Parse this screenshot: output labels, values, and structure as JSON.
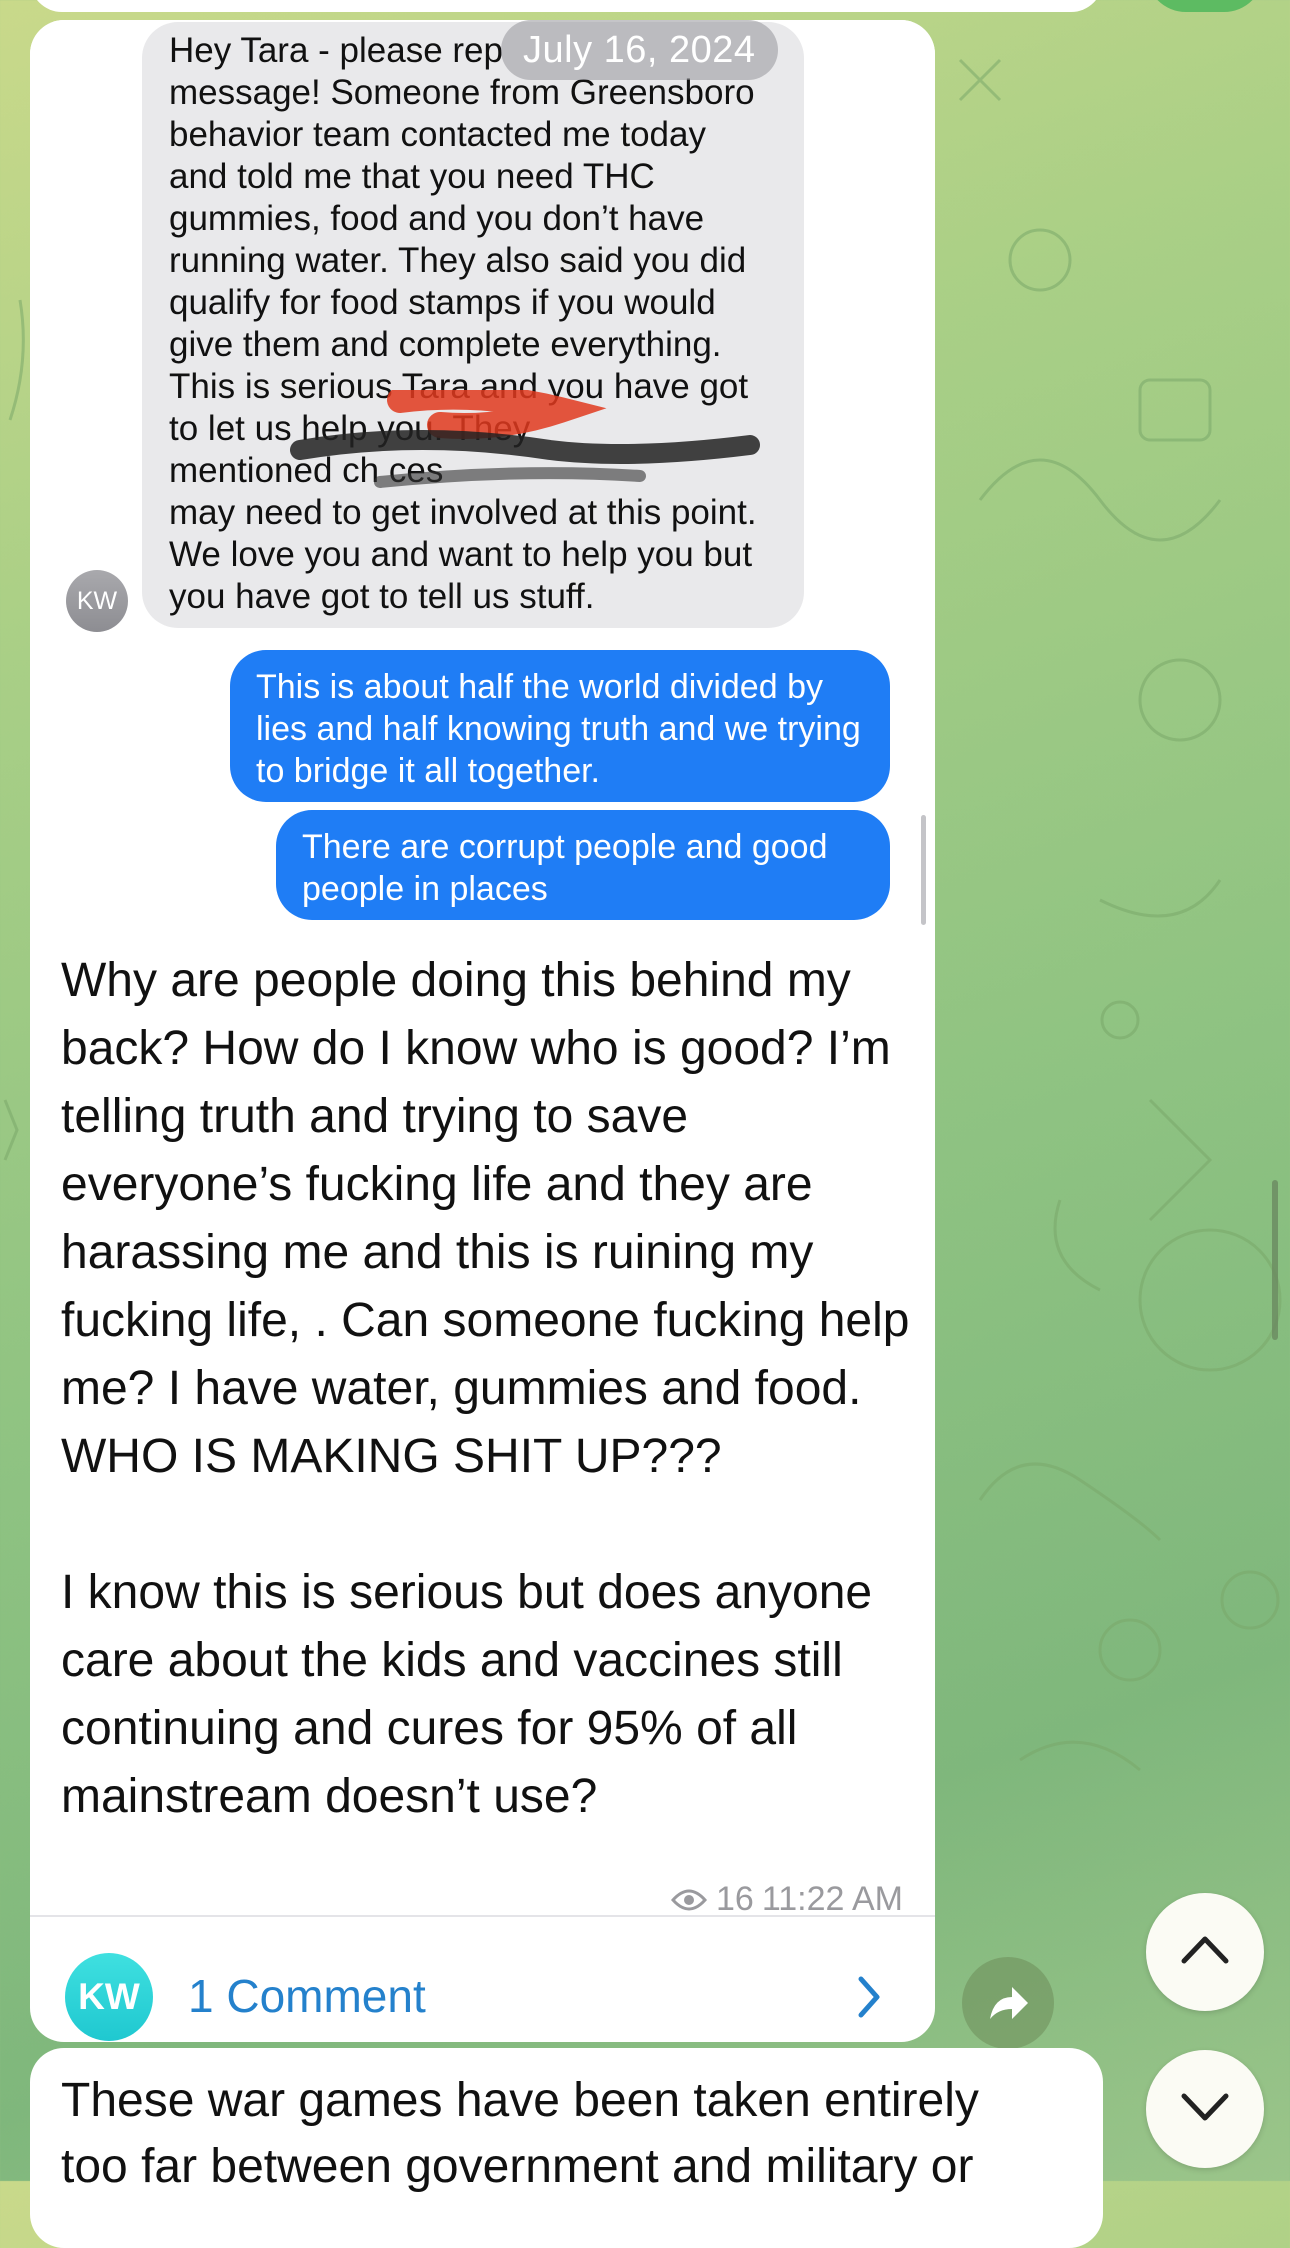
{
  "screenshot": {
    "date_pill": "July 16, 2024",
    "incoming_avatar_initials": "KW",
    "incoming_text": "Hey Tara - please rep\nmessage! Someone from Greensboro\nbehavior team  contacted me today\nand told me that you need THC\ngummies, food and you don’t have\nrunning water. They also said you did\nqualify for food stamps if you would\ngive them and complete everything.\nThis is serious Tara and you have got\nto let us help you. They\nmentioned ch                  ces\nmay need to get involved at this point.\nWe love you and want to help you but\nyou have got to tell us stuff.",
    "outgoing_1": "This is about half the world divided by lies and half knowing truth and we trying to bridge it all together.",
    "outgoing_2": "There are corrupt people and good people in places"
  },
  "post": {
    "text": "Why are people doing this behind my back? How do I know who is good? I’m telling truth and trying to save everyone’s fucking life and they are harassing me and this is ruining my fucking life, . Can someone fucking help me? I have water, gummies and food. WHO IS MAKING SHIT UP???\n\nI know this is serious but does anyone care about the kids and vaccines still continuing and cures for 95% of all mainstream doesn’t use?",
    "views": "16",
    "time": "11:22 AM",
    "view_icon": "eye-icon"
  },
  "comments": {
    "avatar_initials": "KW",
    "label": "1 Comment",
    "chevron_icon": "chevron-right-icon"
  },
  "next_post": {
    "text": "These war games have been taken entirely\ntoo far between government and military or"
  },
  "controls": {
    "share_icon": "share-arrow-icon",
    "scroll_up_icon": "chevron-up-icon",
    "scroll_down_icon": "chevron-down-icon"
  },
  "colors": {
    "outgoing_bubble": "#1f7df5",
    "incoming_bubble": "#e9e9eb",
    "link": "#2481cc",
    "comment_avatar": "#1fc8d0"
  }
}
